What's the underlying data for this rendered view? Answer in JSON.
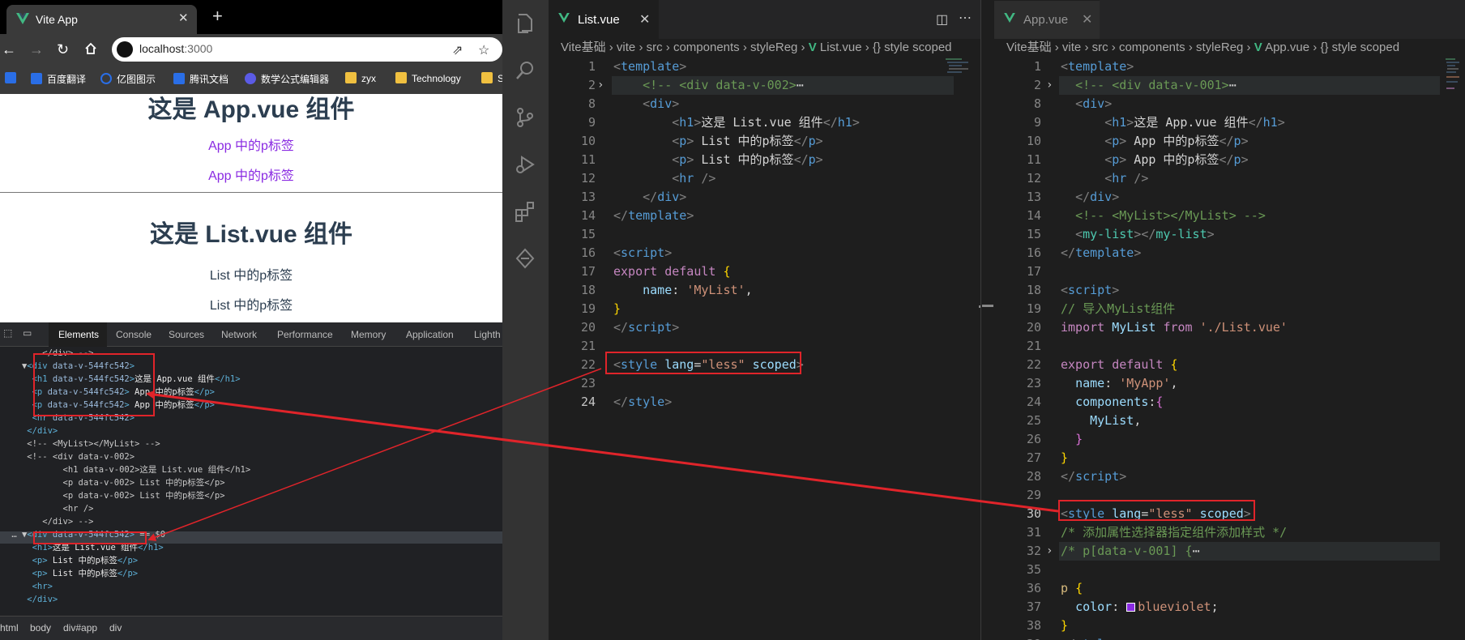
{
  "browser": {
    "tab_title": "Vite App",
    "tab_close": "✕",
    "new_tab": "+",
    "url_host": "localhost",
    "url_port": ":3000",
    "bookmarks": [
      "百度翻译",
      "亿图图示",
      "腾讯文档",
      "数学公式编辑器",
      "zyx",
      "Technology",
      "S"
    ],
    "page": {
      "app_h1": "这是 App.vue 组件",
      "app_p1": "App 中的p标签",
      "app_p2": "App 中的p标签",
      "list_h1": "这是 List.vue 组件",
      "list_p1": "List 中的p标签",
      "list_p2": "List 中的p标签"
    },
    "devtools": {
      "tabs": [
        "Elements",
        "Console",
        "Sources",
        "Network",
        "Performance",
        "Memory",
        "Application",
        "Lighth"
      ],
      "breadcrumbs": [
        "html",
        "body",
        "div#app",
        "div"
      ],
      "eq_marker": "== $0"
    },
    "colors": {
      "p_color": "#8a2be2",
      "vue_green": "#41b883",
      "red_annotation": "#e0242a"
    }
  },
  "editor_left": {
    "tab": "List.vue",
    "breadcrumb": [
      "Vite基础",
      "vite",
      "src",
      "components",
      "styleReg",
      "List.vue",
      "{} style scoped"
    ]
  },
  "editor_right": {
    "tab": "App.vue",
    "breadcrumb": [
      "Vite基础",
      "vite",
      "src",
      "components",
      "styleReg",
      "App.vue",
      "{} style scoped"
    ]
  }
}
